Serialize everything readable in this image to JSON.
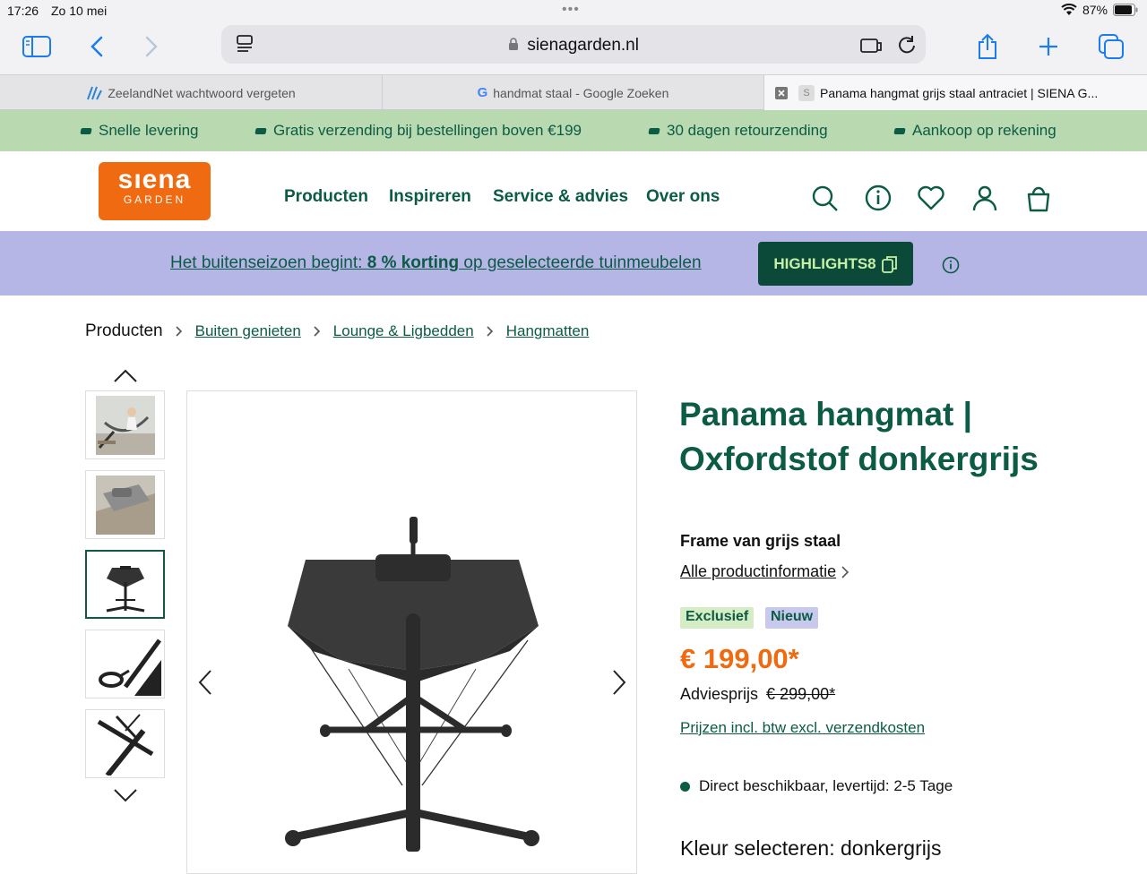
{
  "status": {
    "time": "17:26",
    "date": "Zo 10 mei",
    "battery": "87%"
  },
  "browser": {
    "url": "sienagarden.nl",
    "tabs": [
      {
        "label": "ZeelandNet wachtwoord vergeten"
      },
      {
        "label": "handmat staal - Google Zoeken"
      },
      {
        "label": "Panama hangmat grijs staal antraciet | SIENA G..."
      }
    ]
  },
  "usp": [
    "Snelle levering",
    "Gratis verzending bij bestellingen boven €199",
    "30 dagen retourzending",
    "Aankoop op rekening"
  ],
  "header": {
    "logo_top": "sıena",
    "logo_bottom": "GARDEN",
    "nav": [
      "Producten",
      "Inspireren",
      "Service & advies",
      "Over ons"
    ]
  },
  "promo": {
    "text_a": "Het buitenseizoen begint: ",
    "text_b": "8 % korting",
    "text_c": " op geselecteerde tuinmeubelen",
    "code": "HIGHLIGHTS8"
  },
  "breadcrumb": {
    "root": "Producten",
    "items": [
      "Buiten genieten",
      "Lounge & Ligbedden",
      "Hangmatten"
    ]
  },
  "product": {
    "title": "Panama hangmat | Oxfordstof donkergrijs",
    "subtitle": "Frame van grijs staal",
    "info_link": "Alle productinformatie",
    "badges": [
      "Exclusief",
      "Nieuw"
    ],
    "price": "€ 199,00*",
    "advies_label": "Adviesprijs",
    "advies_price": "€ 299,00*",
    "vat_note": "Prijzen incl. btw excl. verzendkosten",
    "stock": "Direct beschikbaar, levertijd: 2-5 Tage",
    "color_select": "Kleur selecteren: donkergrijs"
  },
  "colors": {
    "brand_green": "#0b5b45",
    "brand_orange": "#ef6a10",
    "usp_bg": "#b9d9b0",
    "promo_bg": "#b5b5e6"
  }
}
